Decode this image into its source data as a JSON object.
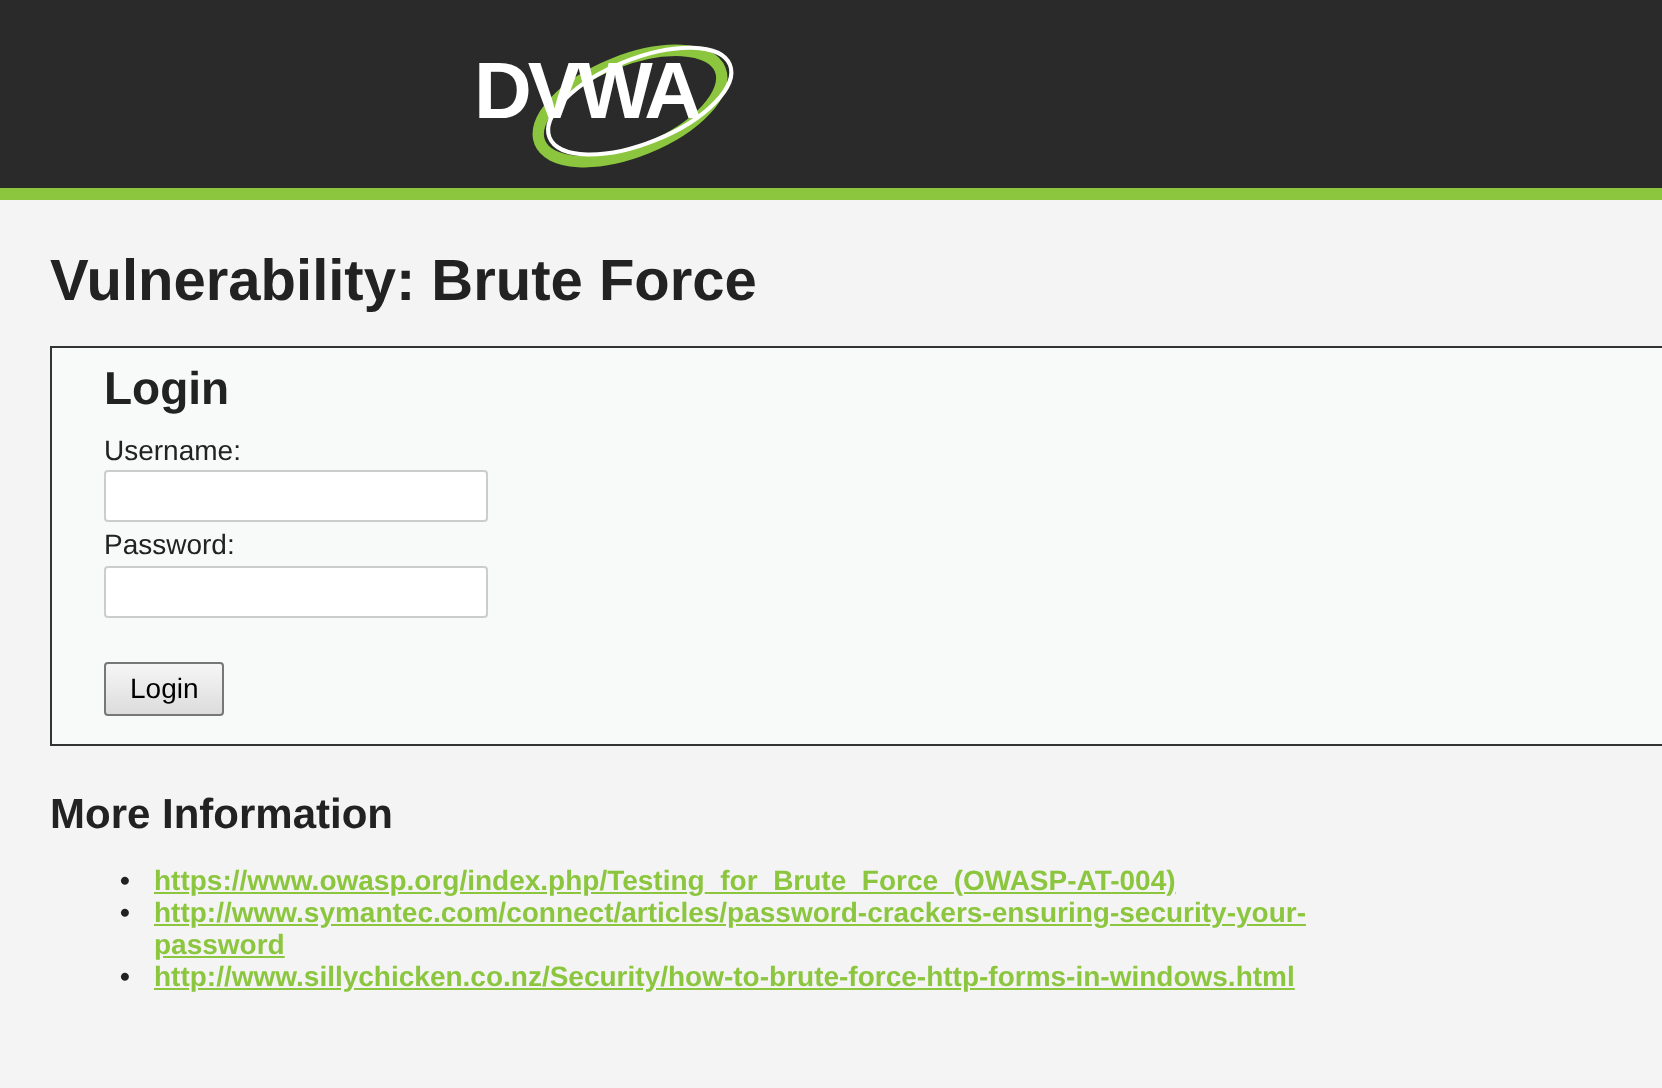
{
  "header": {
    "logo": "DVWA"
  },
  "title": "Vulnerability: Brute Force",
  "login": {
    "heading": "Login",
    "fields": [
      {
        "label": "Username:"
      },
      {
        "label": "Password:"
      }
    ],
    "button": "Login"
  },
  "more_information": {
    "heading": "More Information",
    "links": [
      {
        "bullet": "•",
        "url": "https://www.owasp.org/index.php/Testing_for_Brute_Force_(OWASP-AT-004)"
      },
      {
        "bullet": "•",
        "url": "http://www.symantec.com/connect/articles/password-crackers-ensuring-security-your-password"
      },
      {
        "bullet": "•",
        "url": "http://www.sillychicken.co.nz/Security/how-to-brute-force-http-forms-in-windows.html"
      }
    ]
  }
}
